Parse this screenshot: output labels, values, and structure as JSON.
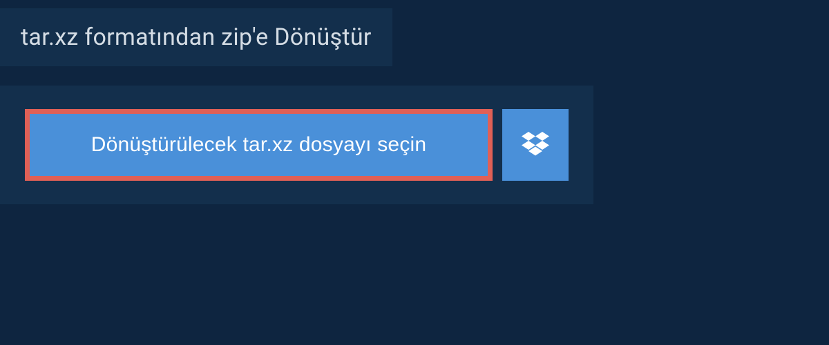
{
  "header": {
    "title": "tar.xz formatından zip'e Dönüştür"
  },
  "upload": {
    "select_file_label": "Dönüştürülecek tar.xz dosyayı seçin"
  },
  "colors": {
    "background": "#0e2540",
    "panel": "#132f4c",
    "button": "#4a90d9",
    "highlight_border": "#e06056"
  }
}
